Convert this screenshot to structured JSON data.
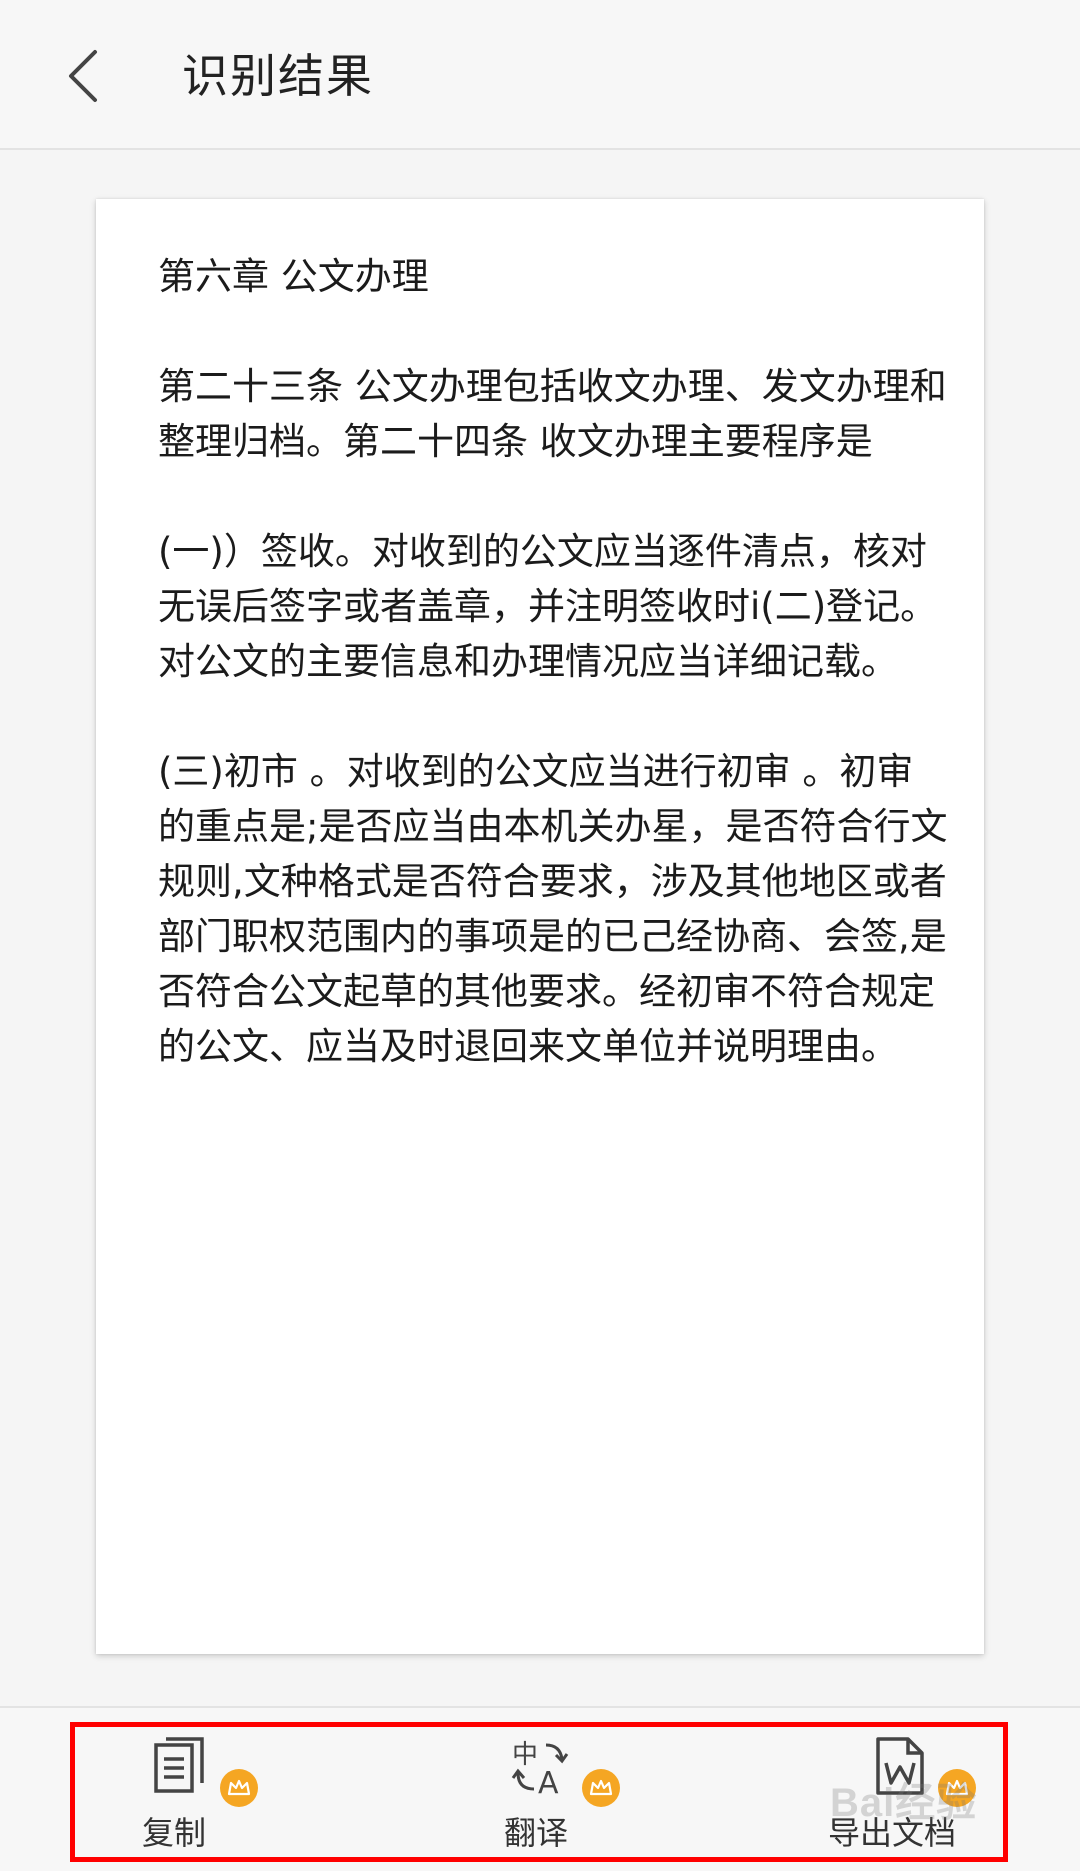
{
  "header": {
    "title": "识别结果",
    "back_icon": "chevron-left-icon"
  },
  "document": {
    "paragraphs": [
      "第六章 公文办理",
      "第二十三条 公文办理包括收文办理、发文办理和整理归档。第二十四条 收文办理主要程序是",
      "(一)）签收。对收到的公文应当逐件清点，核对无误后签字或者盖章，并注明签收时i(二)登记。对公文的主要信息和办理情况应当详细记载。",
      "(三)初市 。对收到的公文应当进行初审 。初审的重点是;是否应当由本机关办星，是否符合行文规则,文种格式是否符合要求，涉及其他地区或者部门职权范围内的事项是的已己经协商、会签,是否符合公文起草的其他要求。经初审不符合规定的公文、应当及时退回来文单位并说明理由。"
    ]
  },
  "actions": {
    "copy": {
      "label": "复制",
      "icon": "copy-document-icon",
      "badge_icon": "crown-icon"
    },
    "translate": {
      "label": "翻译",
      "icon": "translate-icon",
      "badge_icon": "crown-icon"
    },
    "export": {
      "label": "导出文档",
      "icon": "word-file-icon",
      "badge_icon": "crown-icon"
    }
  },
  "colors": {
    "accent_crown": "#f5a623",
    "highlight_box": "#ff0000"
  },
  "watermark": "Bai经验"
}
